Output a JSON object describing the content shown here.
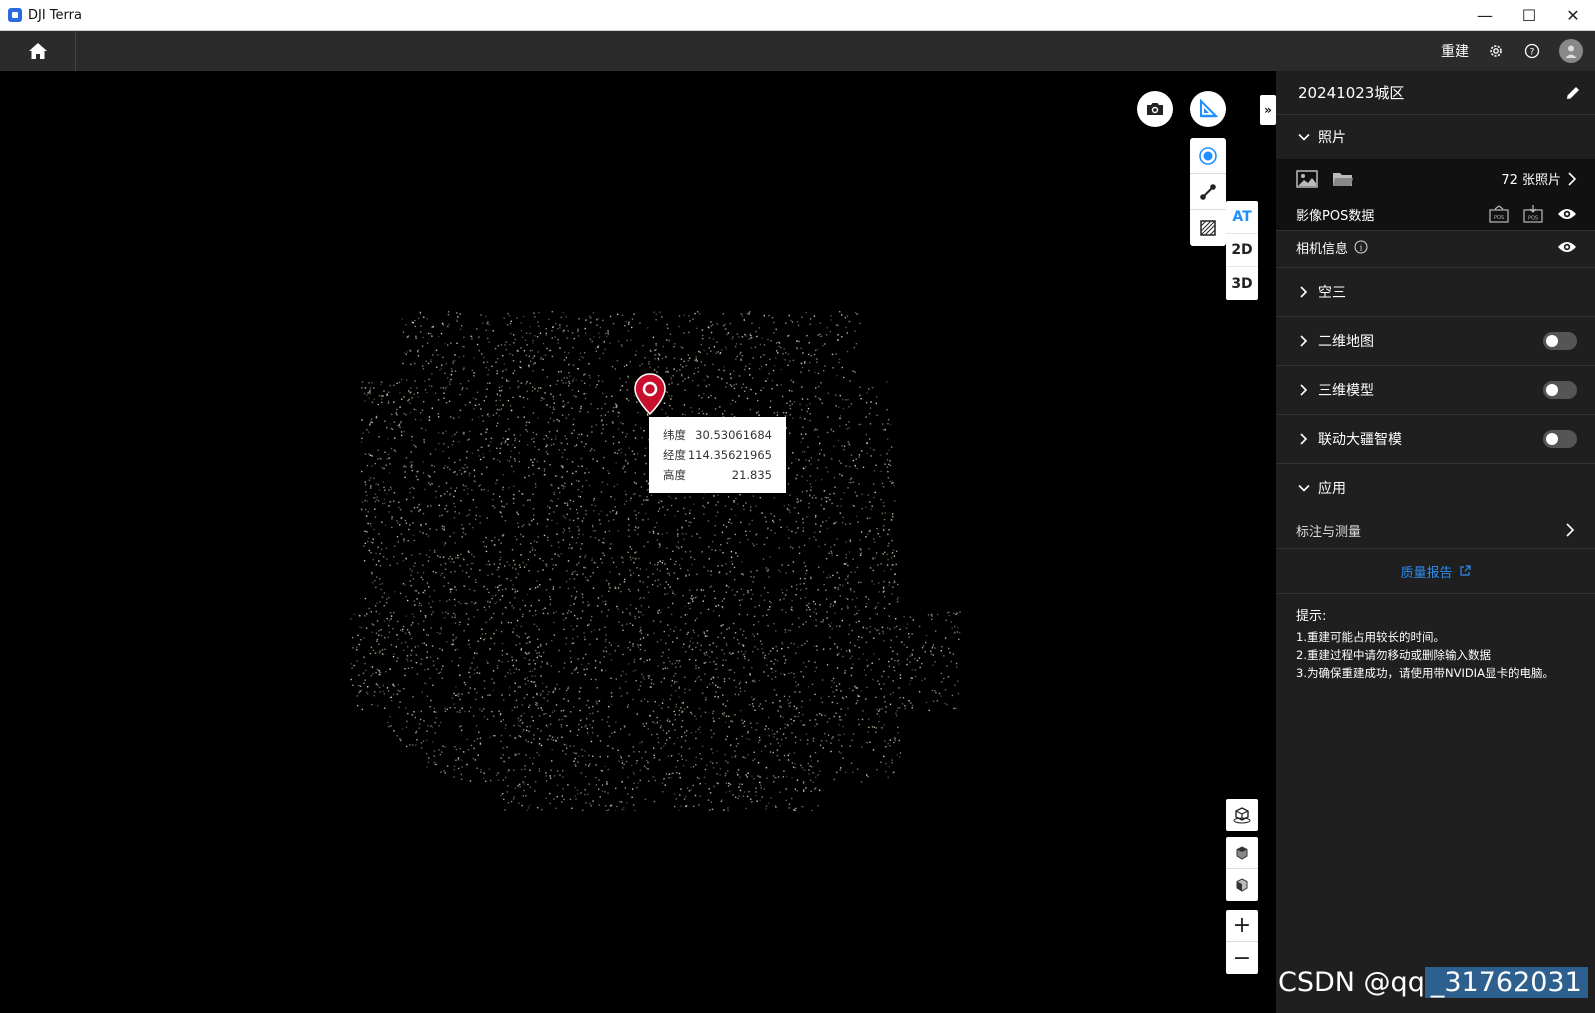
{
  "window": {
    "title": "DJI Terra",
    "minimize": "—",
    "maximize": "☐",
    "close": "✕"
  },
  "topbar": {
    "rebuild_label": "重建",
    "icons": [
      "home-icon",
      "gear-icon",
      "help-icon",
      "user-icon"
    ]
  },
  "viewport": {
    "modes": [
      "AT",
      "2D",
      "3D"
    ],
    "active_mode": "AT",
    "collapse_label": "»",
    "point_popup": {
      "lat_label": "纬度",
      "lat_value": "30.53061684",
      "lon_label": "经度",
      "lon_value": "114.35621965",
      "alt_label": "高度",
      "alt_value": "21.835"
    },
    "zoom_in": "+",
    "zoom_out": "−"
  },
  "panel": {
    "project_name": "20241023城区",
    "photos": {
      "section_label": "照片",
      "count_text": "72 张照片",
      "pos_label": "影像POS数据",
      "camera_label": "相机信息"
    },
    "sections": [
      {
        "label": "空三",
        "toggle": false
      },
      {
        "label": "二维地图",
        "toggle": true
      },
      {
        "label": "三维模型",
        "toggle": true
      },
      {
        "label": "联动大疆智模",
        "toggle": true
      }
    ],
    "apply": {
      "section_label": "应用",
      "item_label": "标注与测量"
    },
    "report_label": "质量报告",
    "tips": {
      "heading": "提示:",
      "lines": [
        "1.重建可能占用较长的时间。",
        "2.重建过程中请勿移动或删除输入数据",
        "3.为确保重建成功，请使用带NVIDIA显卡的电脑。"
      ]
    }
  },
  "watermark": {
    "prefix": "CSDN @qq",
    "highlight": "_31762031"
  },
  "colors": {
    "accent": "#2d8cf0",
    "pin": "#c8102e",
    "panel_bg": "#1f1f1f"
  }
}
